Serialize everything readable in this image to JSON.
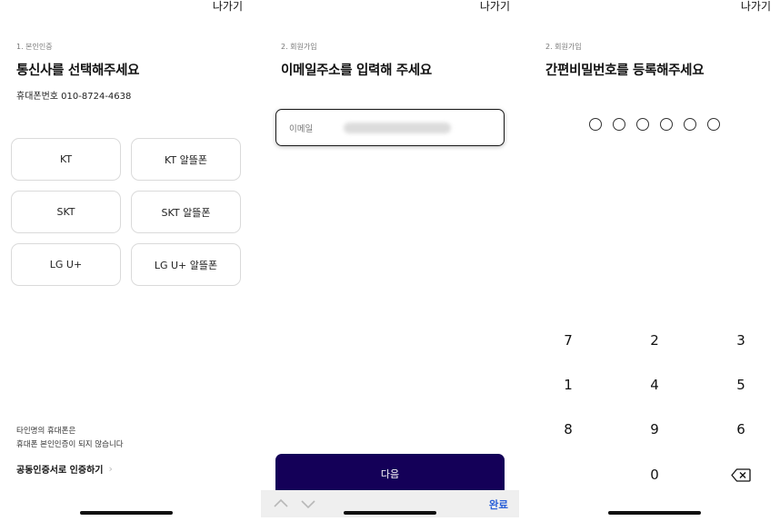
{
  "panel1": {
    "exit": "나가기",
    "step": "1. 본인인증",
    "title": "통신사를 선택해주세요",
    "phone": "휴대폰번호 010-8724-4638",
    "carriers": [
      "KT",
      "KT 알뜰폰",
      "SKT",
      "SKT 알뜰폰",
      "LG U+",
      "LG U+ 알뜰폰"
    ],
    "notice_line1": "타인명의 휴대폰은",
    "notice_line2": "휴대폰 본인인증이 되지 않습니다",
    "cert_link": "공동인증서로 인증하기"
  },
  "panel2": {
    "exit": "나가기",
    "step": "2. 회원가입",
    "title": "이메일주소를 입력해 주세요",
    "email_label": "이메일",
    "next_button": "다음",
    "done": "완료"
  },
  "panel3": {
    "exit": "나가기",
    "step": "2. 회원가입",
    "title": "간편비밀번호를 등록해주세요",
    "pin_length": 6,
    "pin_filled": 0,
    "keypad": [
      "7",
      "2",
      "3",
      "1",
      "4",
      "5",
      "8",
      "9",
      "6",
      "0"
    ]
  },
  "colors": {
    "primary_button": "#140058",
    "done_link": "#2d62d8"
  },
  "icons": {
    "backspace": "backspace-icon",
    "keyboard_prev": "chevron-up-icon",
    "keyboard_next": "chevron-down-icon",
    "link_chevron": "chevron-right-icon"
  }
}
